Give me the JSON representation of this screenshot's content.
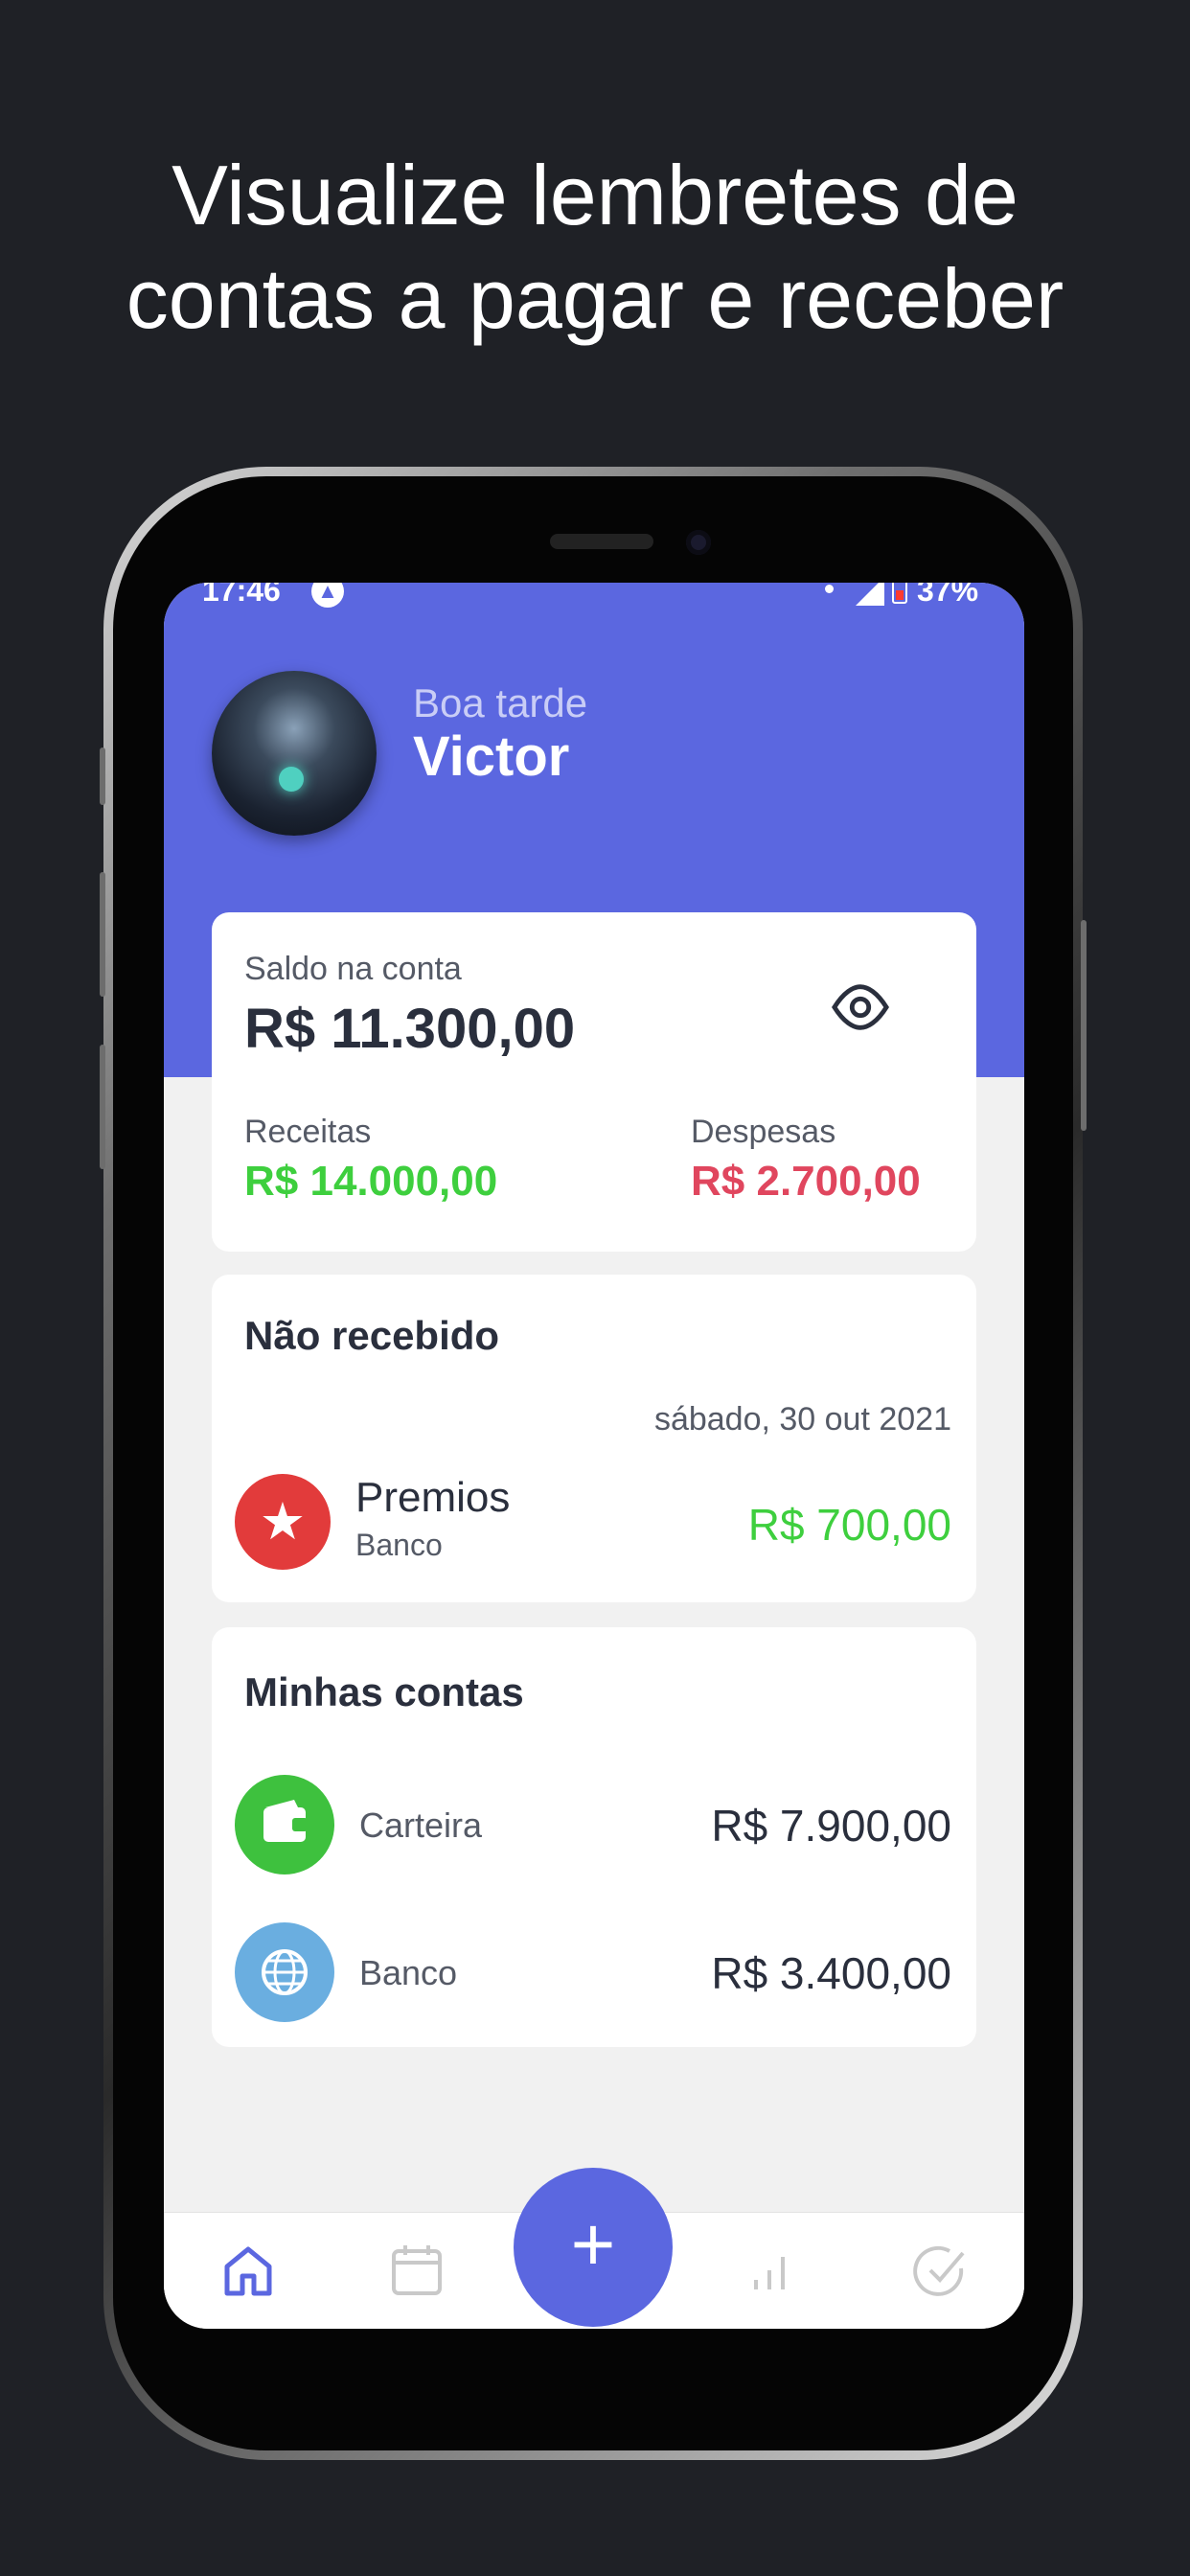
{
  "headline": {
    "line1": "Visualize lembretes de",
    "line2": "contas a pagar e receber"
  },
  "status_bar": {
    "time": "17:46",
    "battery": "37%"
  },
  "header": {
    "greeting": "Boa tarde",
    "user_name": "Victor"
  },
  "balance": {
    "label": "Saldo na conta",
    "value": "R$ 11.300,00",
    "income_label": "Receitas",
    "income_value": "R$ 14.000,00",
    "expense_label": "Despesas",
    "expense_value": "R$ 2.700,00"
  },
  "pending": {
    "title": "Não recebido",
    "date": "sábado, 30 out 2021",
    "item_title": "Premios",
    "item_account": "Banco",
    "item_value": "R$ 700,00"
  },
  "accounts": {
    "title": "Minhas contas",
    "items": [
      {
        "name": "Carteira",
        "value": "R$ 7.900,00",
        "icon": "wallet-icon",
        "color": "#3ec13e"
      },
      {
        "name": "Banco",
        "value": "R$ 3.400,00",
        "icon": "globe-icon",
        "color": "#6aaee0"
      }
    ]
  },
  "nav": {
    "items": [
      "home-icon",
      "calendar-icon",
      "chart-icon",
      "check-icon"
    ],
    "fab_label": "+"
  },
  "colors": {
    "primary": "#5b67e0",
    "income": "#3ecf3e",
    "expense": "#e0465e",
    "background": "#1f2126"
  }
}
